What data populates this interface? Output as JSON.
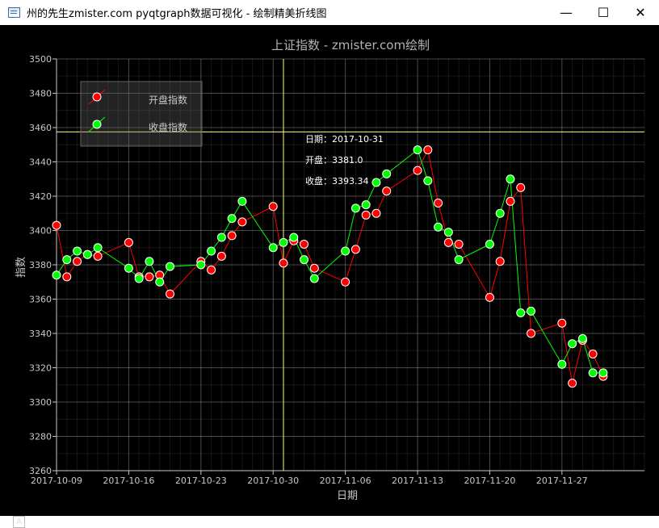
{
  "window": {
    "title": "州的先生zmister.com pyqtgraph数据可视化 - 绘制精美折线图",
    "minimize_glyph": "—",
    "maximize_glyph": "☐",
    "close_glyph": "✕",
    "auto_range_label": "A"
  },
  "tooltip": {
    "date": "日期：2017-10-31",
    "open": "开盘：3381.0",
    "close": "收盘：3393.34"
  },
  "colors": {
    "open_series": "#ff0000",
    "close_series": "#00ff00",
    "crosshair": "#ffff80",
    "axis": "#c8c8c8"
  },
  "chart_data": {
    "type": "line",
    "title": "上证指数 - zmister.com绘制",
    "xlabel": "日期",
    "ylabel": "指数",
    "ylim": [
      3260,
      3500
    ],
    "yticks": [
      3260,
      3280,
      3300,
      3320,
      3340,
      3360,
      3380,
      3400,
      3420,
      3440,
      3460,
      3480,
      3500
    ],
    "xlim": [
      "2017-10-09",
      "2017-12-05"
    ],
    "xticks": [
      "2017-10-09",
      "2017-10-16",
      "2017-10-23",
      "2017-10-30",
      "2017-11-06",
      "2017-11-13",
      "2017-11-20",
      "2017-11-27"
    ],
    "grid": true,
    "legend_position": "top-left",
    "x": [
      "2017-10-09",
      "2017-10-10",
      "2017-10-11",
      "2017-10-12",
      "2017-10-13",
      "2017-10-16",
      "2017-10-17",
      "2017-10-18",
      "2017-10-19",
      "2017-10-20",
      "2017-10-23",
      "2017-10-24",
      "2017-10-25",
      "2017-10-26",
      "2017-10-27",
      "2017-10-30",
      "2017-10-31",
      "2017-11-01",
      "2017-11-02",
      "2017-11-03",
      "2017-11-06",
      "2017-11-07",
      "2017-11-08",
      "2017-11-09",
      "2017-11-10",
      "2017-11-13",
      "2017-11-14",
      "2017-11-15",
      "2017-11-16",
      "2017-11-17",
      "2017-11-20",
      "2017-11-21",
      "2017-11-22",
      "2017-11-23",
      "2017-11-24",
      "2017-11-27",
      "2017-11-28",
      "2017-11-29",
      "2017-11-30",
      "2017-12-01"
    ],
    "series": [
      {
        "name": "开盘指数",
        "color": "#ff0000",
        "values": [
          3403,
          3373,
          3382,
          3386,
          3385,
          3393,
          3373,
          3373,
          3374,
          3363,
          3382,
          3377,
          3385,
          3397,
          3405,
          3414,
          3381,
          3394,
          3392,
          3378,
          3370,
          3389,
          3409,
          3410,
          3423,
          3435,
          3447,
          3416,
          3393,
          3392,
          3361,
          3382,
          3417,
          3425,
          3340,
          3346,
          3311,
          3336,
          3328,
          3315
        ]
      },
      {
        "name": "收盘指数",
        "color": "#00ff00",
        "values": [
          3374,
          3383,
          3388,
          3386,
          3390,
          3378,
          3372,
          3382,
          3370,
          3379,
          3380,
          3388,
          3396,
          3407,
          3417,
          3390,
          3393,
          3396,
          3383,
          3372,
          3388,
          3413,
          3415,
          3428,
          3433,
          3447,
          3429,
          3402,
          3399,
          3383,
          3392,
          3410,
          3430,
          3352,
          3353,
          3322,
          3334,
          3337,
          3317,
          3317
        ]
      }
    ],
    "crosshair": {
      "x": "2017-10-31",
      "y": 3457.5
    }
  }
}
